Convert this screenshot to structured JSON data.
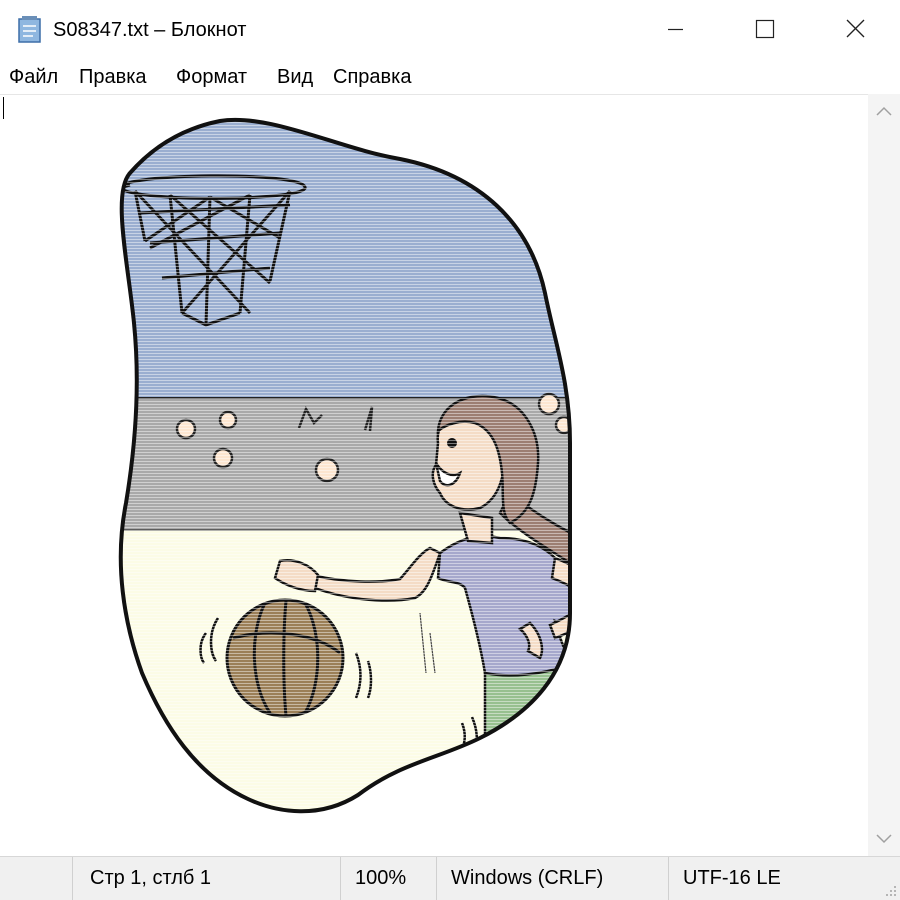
{
  "window": {
    "title": "S08347.txt – Блокнот",
    "app_icon": "notepad-icon",
    "controls": [
      "minimize-icon",
      "maximize-icon",
      "close-icon"
    ]
  },
  "menu": {
    "file": "Файл",
    "edit": "Правка",
    "format": "Формат",
    "view": "Вид",
    "help": "Справка"
  },
  "editor": {
    "content": "ASCII-style cartoon illustration",
    "colors": {
      "sky": "#9aaed0",
      "wall": "#a9a9a9",
      "floor": "#fcfce6",
      "hair": "#9c7e72",
      "shirt": "#a6a8cc",
      "shorts": "#97c08f",
      "ball": "#9b7f57",
      "skin": "#f4dcc6"
    }
  },
  "scrollbar": {
    "up_icon": "chevron-up-icon",
    "down_icon": "chevron-down-icon"
  },
  "status": {
    "position": "Стр 1, стлб 1",
    "zoom": "100%",
    "line_ending": "Windows (CRLF)",
    "encoding": "UTF-16 LE"
  }
}
